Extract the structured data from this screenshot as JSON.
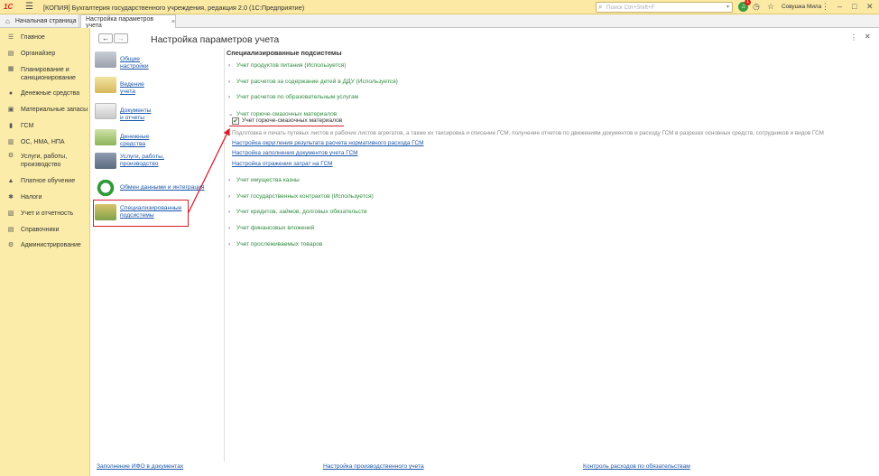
{
  "window": {
    "app_title": "[КОПИЯ] Бухгалтерия государственного учреждения, редакция 2.0  (1С:Предприятие)",
    "search_placeholder": "Поиск Ctrl+Shift+F",
    "notification_count": "1",
    "user_name": "Совушка Мила"
  },
  "tabs": [
    {
      "label": "Начальная страница"
    },
    {
      "label": "Настройка параметров учета",
      "close": "×"
    }
  ],
  "sidebar": {
    "items": [
      {
        "label": "Главное",
        "icon": "home-icon"
      },
      {
        "label": "Органайзер",
        "icon": "organizer-icon"
      },
      {
        "label": "Планирование и санкционирование",
        "icon": "planning-icon"
      },
      {
        "label": "Денежные средства",
        "icon": "money-icon"
      },
      {
        "label": "Материальные запасы",
        "icon": "materials-icon"
      },
      {
        "label": "ГСМ",
        "icon": "fuel-icon"
      },
      {
        "label": "ОС, НМА, НПА",
        "icon": "assets-icon"
      },
      {
        "label": "Услуги, работы, производство",
        "icon": "services-icon"
      },
      {
        "label": "Платное обучение",
        "icon": "education-icon"
      },
      {
        "label": "Налоги",
        "icon": "taxes-icon"
      },
      {
        "label": "Учет и отчетность",
        "icon": "reporting-icon"
      },
      {
        "label": "Справочники",
        "icon": "directories-icon"
      },
      {
        "label": "Администрирование",
        "icon": "admin-icon"
      }
    ]
  },
  "page": {
    "title": "Настройка параметров учета",
    "left_nav": [
      {
        "label": "Общие настройки"
      },
      {
        "label": "Ведение учета"
      },
      {
        "label": "Документы и отчеты"
      },
      {
        "label": "Денежные средства"
      },
      {
        "label": "Услуги, работы, производство"
      },
      {
        "label": "Обмен данными и интеграция"
      },
      {
        "label": "Специализированные подсистемы"
      }
    ],
    "section_title": "Специализированные подсистемы",
    "groups": [
      {
        "label": "Учет продуктов питания (Используется)"
      },
      {
        "label": "Учет расчетов за содержание детей в ДДУ (Используется)"
      },
      {
        "label": "Учет расчетов по образовательным услугам"
      },
      {
        "label": "Учет горюче-смазочных материалов"
      },
      {
        "label": "Учет имущества казны"
      },
      {
        "label": "Учет государственных контрактов (Используется)"
      },
      {
        "label": "Учет кредитов, займов, долговых обязательств"
      },
      {
        "label": "Учет финансовых вложений"
      },
      {
        "label": "Учет прослеживаемых товаров"
      }
    ],
    "fuel": {
      "checkbox_label": "Учет горюче-смазочных материалов",
      "checked": true,
      "description": "Подготовка и печать путевых листов и рабочих листов агрегатов, а также их таксировка и списание ГСМ, получение отчетов по движениям документов и расходу ГСМ в разрезах основных средств, сотрудников и видов ГСМ",
      "links": [
        "Настройка округления результата расчета нормативного расхода ГСМ",
        "Настройка заполнения документов учета ГСМ",
        "Настройка отражения затрат на ГСМ"
      ]
    },
    "footer_links": [
      "Заполнение ИФО в документах",
      "Настройка производственного учета",
      "Контроль расходов по обязательствам"
    ]
  },
  "colors": {
    "topbar": "#fbe9a4",
    "sidebar": "#fbeca9",
    "link": "#1d57a8",
    "group": "#2f8a3f",
    "highlight": "#d91e2a"
  }
}
